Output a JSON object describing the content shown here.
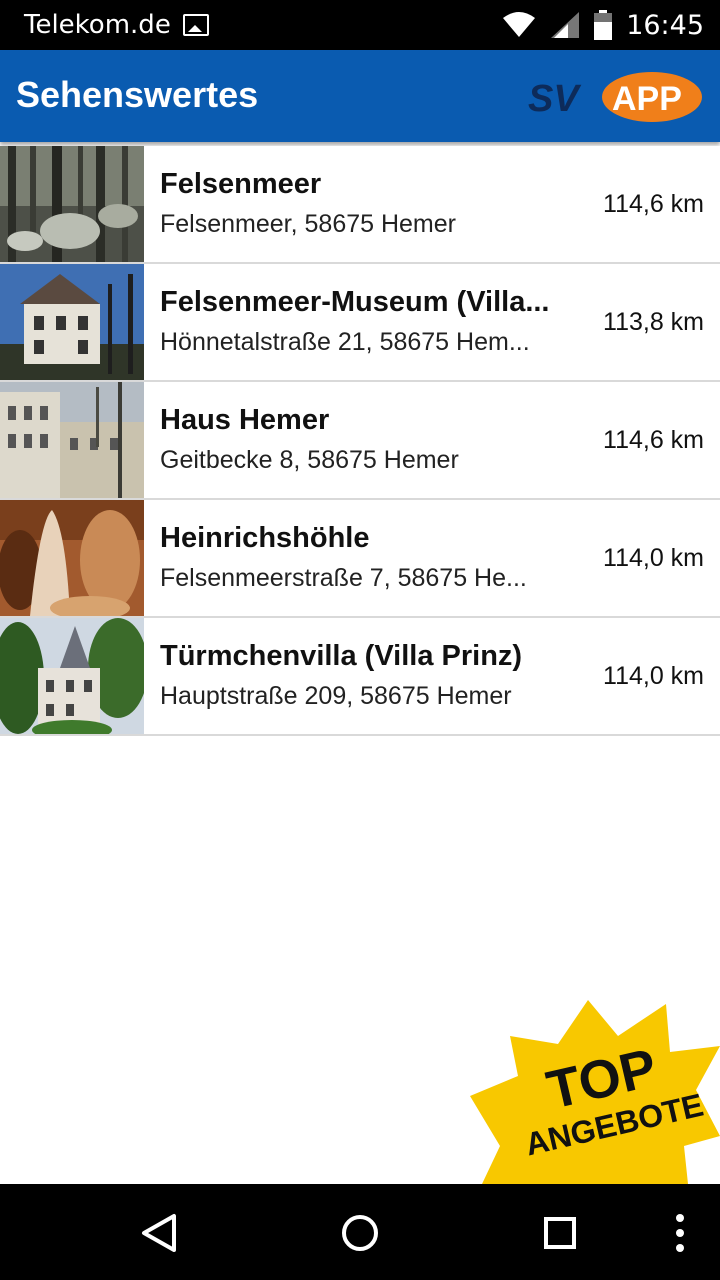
{
  "status_bar": {
    "carrier": "Telekom.de",
    "time": "16:45",
    "icons": [
      "image-notification-icon",
      "wifi-icon",
      "signal-icon",
      "battery-icon"
    ]
  },
  "app_bar": {
    "title": "Sehenswertes",
    "logo_left": "SV",
    "logo_right": "APP",
    "colors": {
      "bar": "#0a5bb0",
      "logo_orange": "#f07f1a",
      "logo_navy": "#0d2b5a"
    }
  },
  "items": [
    {
      "name": "Felsenmeer",
      "address": "Felsenmeer, 58675 Hemer",
      "distance": "114,6 km",
      "thumb": "forest-rocks-image"
    },
    {
      "name": "Felsenmeer-Museum (Villa...",
      "address": "Hönnetalstraße 21, 58675 Hem...",
      "distance": "113,8 km",
      "thumb": "villa-image"
    },
    {
      "name": "Haus Hemer",
      "address": "Geitbecke 8, 58675 Hemer",
      "distance": "114,6 km",
      "thumb": "manor-house-image"
    },
    {
      "name": "Heinrichshöhle",
      "address": "Felsenmeerstraße 7, 58675 He...",
      "distance": "114,0 km",
      "thumb": "cave-image"
    },
    {
      "name": "Türmchenvilla (Villa Prinz)",
      "address": "Hauptstraße 209, 58675 Hemer",
      "distance": "114,0 km",
      "thumb": "tower-villa-image"
    }
  ],
  "badge": {
    "line1": "TOP",
    "line2": "ANGEBOTE",
    "color": "#f8c800"
  },
  "nav": [
    "back-icon",
    "home-icon",
    "recents-icon",
    "more-icon"
  ]
}
